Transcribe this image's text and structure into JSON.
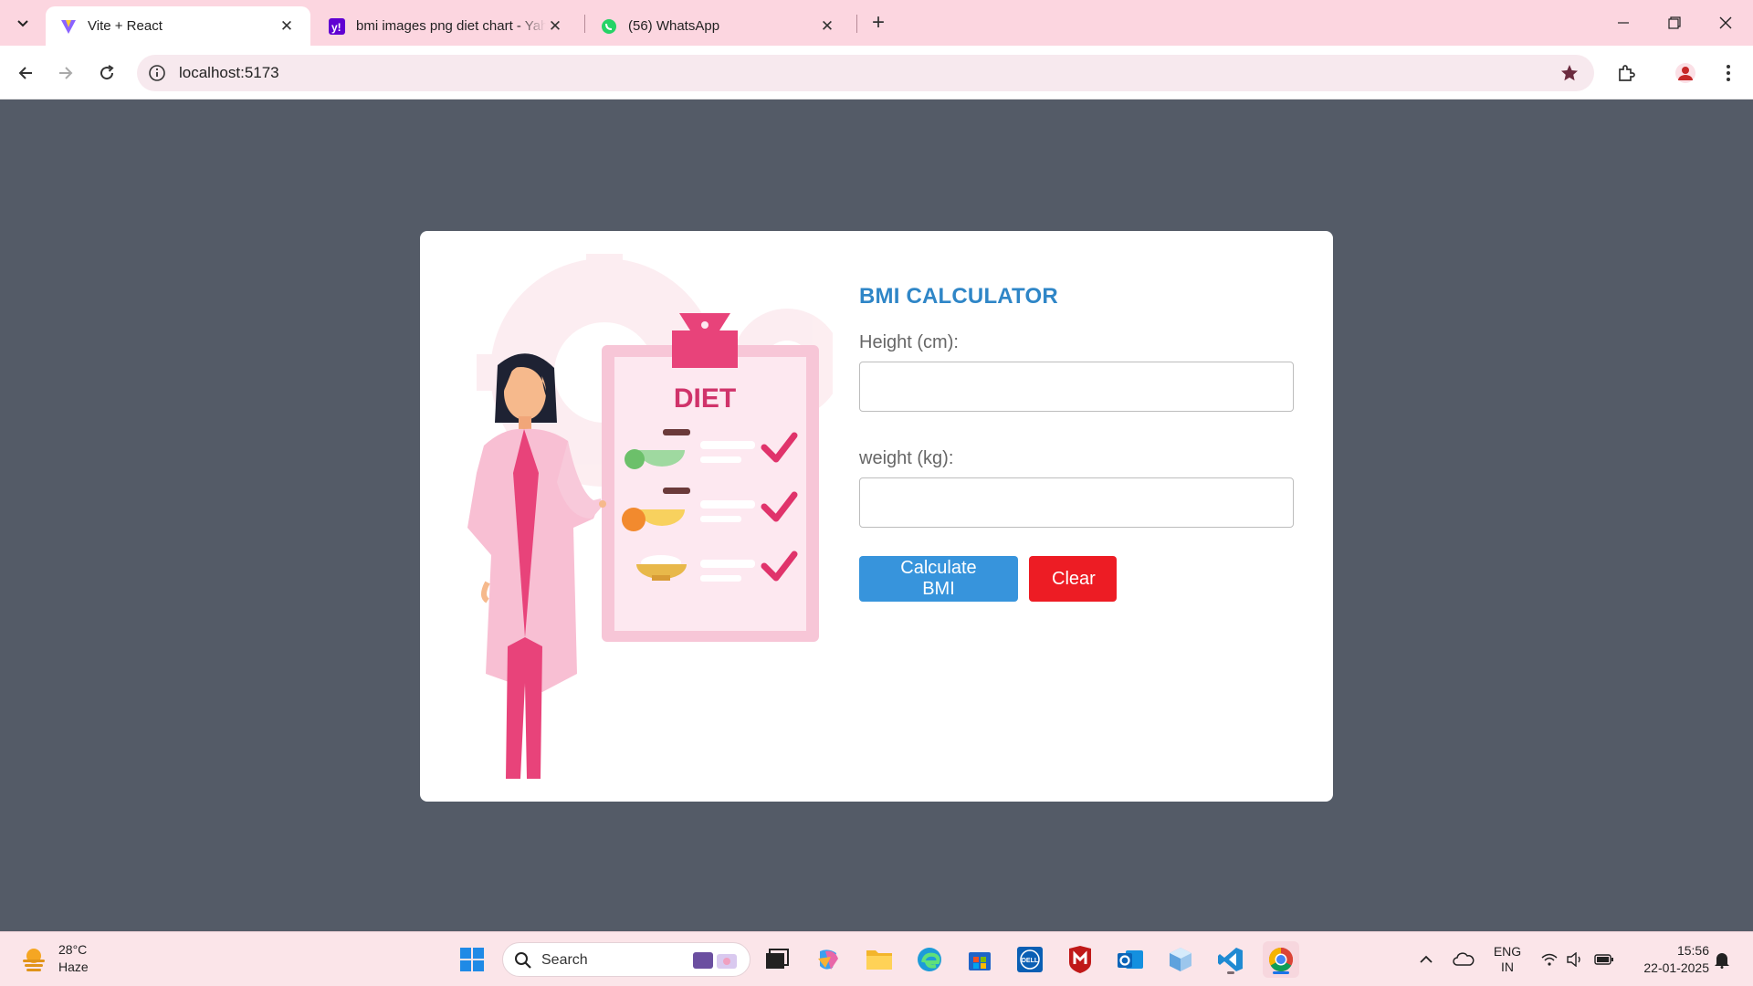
{
  "browser": {
    "tabs": [
      {
        "title": "Vite + React",
        "active": true
      },
      {
        "title": "bmi images png diet chart - Yahoo",
        "active": false
      },
      {
        "title": "(56) WhatsApp",
        "active": false
      }
    ],
    "url": "localhost:5173"
  },
  "page": {
    "illustration_text": "DIET",
    "heading": "BMI CALCULATOR",
    "height_label": "Height (cm):",
    "weight_label": "weight (kg):",
    "height_value": "",
    "weight_value": "",
    "calculate_label": "Calculate BMI",
    "clear_label": "Clear"
  },
  "taskbar": {
    "weather_temp": "28°C",
    "weather_desc": "Haze",
    "search_placeholder": "Search",
    "lang_line1": "ENG",
    "lang_line2": "IN",
    "time": "15:56",
    "date": "22-01-2025"
  },
  "colors": {
    "page_background": "#545b67",
    "heading": "#2f86c7",
    "calculate_button": "#3794dc",
    "clear_button": "#ed1c24",
    "tabstrip": "#fcd6e0"
  }
}
